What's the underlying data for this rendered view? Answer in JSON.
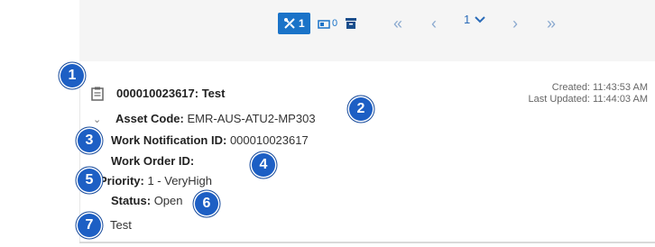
{
  "toolbar": {
    "filter_count": "1",
    "attachment_count": "0",
    "page": "1",
    "first_label": "«",
    "prev_label": "‹",
    "next_label": "›",
    "last_label": "»",
    "accent": "#1a73c8"
  },
  "record": {
    "title": "000010023617: Test",
    "created": "Created: 11:43:53 AM",
    "last_updated": "Last Updated: 11:44:03 AM",
    "asset_code_label": "Asset Code:",
    "asset_code_value": "EMR-AUS-ATU2-MP303",
    "notification_label": "Work Notification ID:",
    "notification_value": "000010023617",
    "work_order_label": "Work Order ID:",
    "work_order_value": "",
    "priority_label": "Priority:",
    "priority_value": "1 - VeryHigh",
    "status_label": "Status:",
    "status_value": "Open",
    "description": "Test"
  },
  "callouts": [
    "1",
    "2",
    "3",
    "4",
    "5",
    "6",
    "7"
  ]
}
